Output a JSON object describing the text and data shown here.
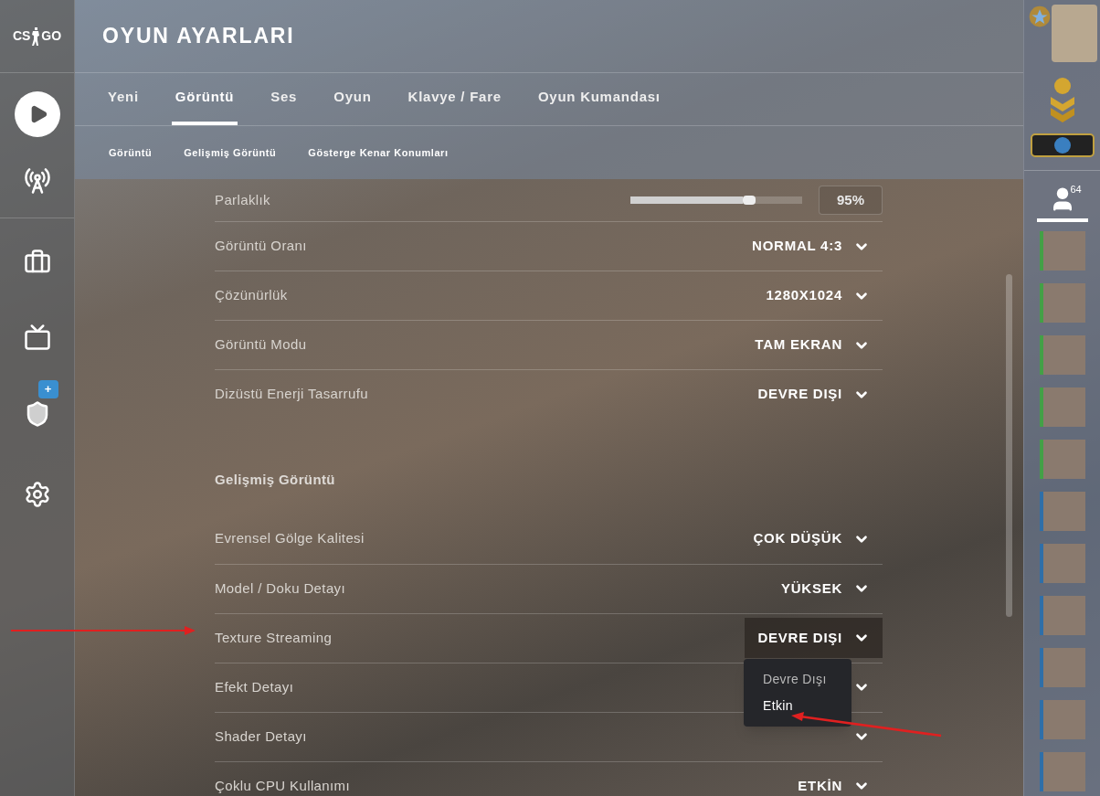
{
  "logo": [
    "CS",
    "GO"
  ],
  "sidebar": {
    "badge": "+"
  },
  "title": "OYUN AYARLARI",
  "tabs": [
    {
      "label": "Yeni",
      "selected": false
    },
    {
      "label": "Görüntü",
      "selected": true
    },
    {
      "label": "Ses",
      "selected": false
    },
    {
      "label": "Oyun",
      "selected": false
    },
    {
      "label": "Klavye / Fare",
      "selected": false
    },
    {
      "label": "Oyun Kumandası",
      "selected": false
    }
  ],
  "subtabs": [
    "Görüntü",
    "Gelişmiş Görüntü",
    "Gösterge Kenar Konumları"
  ],
  "sections": [
    {
      "rows": [
        {
          "kind": "slider",
          "label": "Parlaklık",
          "level": 0.69,
          "value": "95%"
        },
        {
          "kind": "dropdown",
          "label": "Görüntü Oranı",
          "value": "NORMAL 4:3"
        },
        {
          "kind": "dropdown",
          "label": "Çözünürlük",
          "value": "1280X1024"
        },
        {
          "kind": "dropdown",
          "label": "Görüntü Modu",
          "value": "TAM EKRAN"
        },
        {
          "kind": "dropdown",
          "label": "Dizüstü Enerji Tasarrufu",
          "value": "DEVRE DIŞI"
        }
      ]
    },
    {
      "heading": "Gelişmiş Görüntü",
      "rows": [
        {
          "kind": "dropdown",
          "label": "Evrensel Gölge Kalitesi",
          "value": "ÇOK DÜŞÜK"
        },
        {
          "kind": "dropdown",
          "label": "Model / Doku Detayı",
          "value": "YÜKSEK"
        },
        {
          "kind": "dropdown",
          "label": "Texture Streaming",
          "value": "DEVRE DIŞI",
          "open": true,
          "options": [
            {
              "label": "Devre Dışı",
              "hovered": false
            },
            {
              "label": "Etkin",
              "hovered": true
            }
          ]
        },
        {
          "kind": "dropdown",
          "label": "Efekt Detayı"
        },
        {
          "kind": "dropdown",
          "label": "Shader Detayı"
        },
        {
          "kind": "dropdown",
          "label": "Çoklu CPU Kullanımı",
          "value": "ETKİN"
        }
      ]
    }
  ],
  "friends": {
    "count": "64",
    "items": [
      {
        "color": "#43a047"
      },
      {
        "color": "#43a047"
      },
      {
        "color": "#43a047"
      },
      {
        "color": "#43a047"
      },
      {
        "color": "#43a047"
      },
      {
        "color": "#2f6fa8"
      },
      {
        "color": "#2f6fa8"
      },
      {
        "color": "#2f6fa8"
      },
      {
        "color": "#2f6fa8"
      },
      {
        "color": "#2f6fa8"
      },
      {
        "color": "#2f6fa8"
      }
    ]
  }
}
